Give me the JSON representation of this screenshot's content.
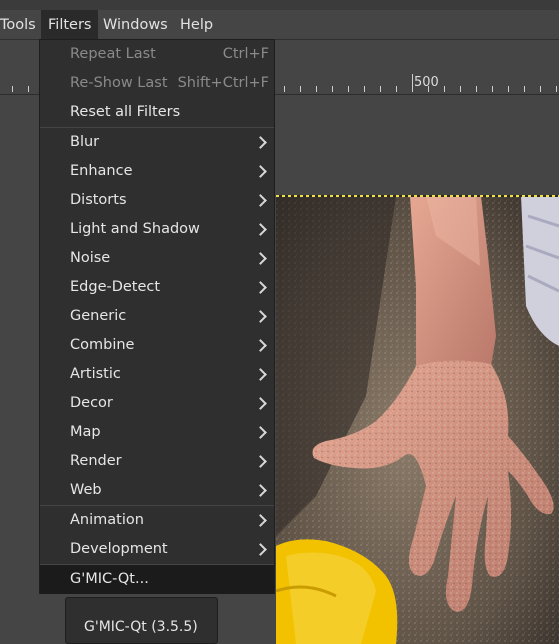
{
  "menubar": {
    "items": [
      "Tools",
      "Filters",
      "Windows",
      "Help"
    ],
    "active": "Filters"
  },
  "ruler": {
    "label": "500"
  },
  "filters_menu": {
    "items": [
      {
        "label": "Repeat Last",
        "shortcut": "Ctrl+F",
        "disabled": true
      },
      {
        "label": "Re-Show Last",
        "shortcut": "Shift+Ctrl+F",
        "disabled": true
      },
      {
        "label": "Reset all Filters"
      },
      {
        "label": "Blur",
        "submenu": true
      },
      {
        "label": "Enhance",
        "submenu": true
      },
      {
        "label": "Distorts",
        "submenu": true
      },
      {
        "label": "Light and Shadow",
        "submenu": true
      },
      {
        "label": "Noise",
        "submenu": true
      },
      {
        "label": "Edge-Detect",
        "submenu": true
      },
      {
        "label": "Generic",
        "submenu": true
      },
      {
        "label": "Combine",
        "submenu": true
      },
      {
        "label": "Artistic",
        "submenu": true
      },
      {
        "label": "Decor",
        "submenu": true
      },
      {
        "label": "Map",
        "submenu": true
      },
      {
        "label": "Render",
        "submenu": true
      },
      {
        "label": "Web",
        "submenu": true
      },
      {
        "label": "Animation",
        "submenu": true
      },
      {
        "label": "Development",
        "submenu": true
      },
      {
        "label": "G'MIC-Qt...",
        "highlighted": true
      }
    ]
  },
  "tooltip": {
    "text": "G'MIC-Qt (3.5.5)"
  },
  "colors": {
    "menu_bg": "#2f2f2f",
    "highlight": "#1b1b1b",
    "selection_marching": "#f0e040",
    "toy_yellow": "#f2c200"
  }
}
